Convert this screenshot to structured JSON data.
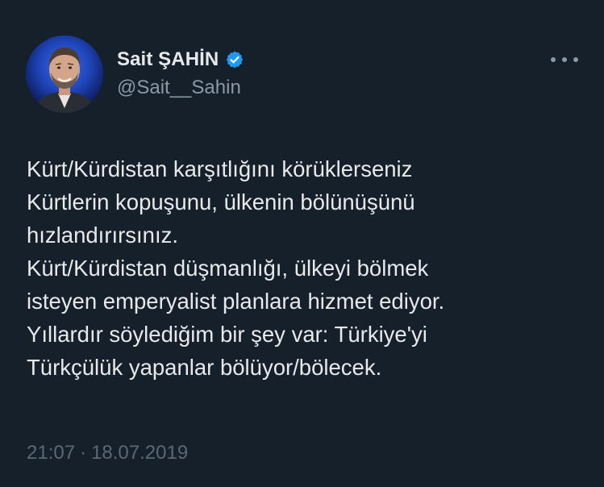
{
  "author": {
    "display_name": "Sait ŞAHİN",
    "handle": "@Sait__Sahin",
    "verified": true,
    "avatar": "profile-photo"
  },
  "tweet": {
    "lines": [
      "Kürt/Kürdistan karşıtlığını körüklerseniz",
      "Kürtlerin kopuşunu, ülkenin bölünüşünü",
      "hızlandırırsınız.",
      "Kürt/Kürdistan düşmanlığı, ülkeyi bölmek",
      "isteyen emperyalist planlara hizmet ediyor.",
      "Yıllardır söylediğim bir şey var: Türkiye'yi",
      "Türkçülük yapanlar bölüyor/bölecek."
    ]
  },
  "meta": {
    "time": "21:07",
    "separator": "·",
    "date": "18.07.2019"
  },
  "icons": {
    "verified": "verified-badge-icon",
    "more": "more-options-icon"
  },
  "colors": {
    "background": "#15202b",
    "text": "#e7e9ea",
    "secondary": "#8b98a5",
    "verified": "#1d9bf0"
  }
}
